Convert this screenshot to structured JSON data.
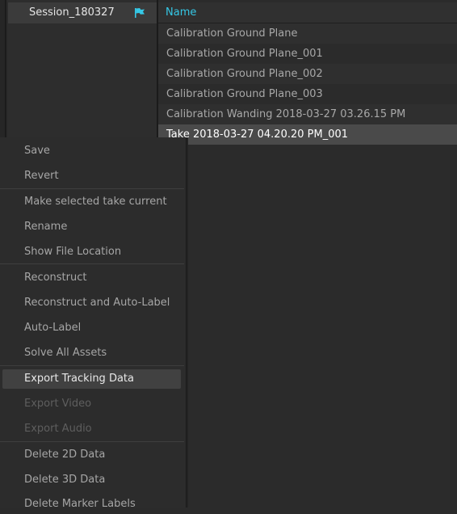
{
  "session_panel": {
    "session_label": "Session_180327",
    "flag_icon_color": "#35c8e6"
  },
  "take_list": {
    "header_label": "Name",
    "rows": [
      {
        "label": "Calibration Ground Plane"
      },
      {
        "label": "Calibration Ground Plane_001"
      },
      {
        "label": "Calibration Ground Plane_002"
      },
      {
        "label": "Calibration Ground Plane_003"
      },
      {
        "label": "Calibration Wanding 2018-03-27 03.26.15 PM"
      },
      {
        "label": "Take 2018-03-27 04.20.20 PM_001"
      }
    ]
  },
  "context_menu": {
    "save": "Save",
    "revert": "Revert",
    "make_current": "Make selected take current",
    "rename": "Rename",
    "show_file_location": "Show File Location",
    "reconstruct": "Reconstruct",
    "reconstruct_auto_label": "Reconstruct and Auto-Label",
    "auto_label": "Auto-Label",
    "solve_all_assets": "Solve All Assets",
    "export_tracking_data": "Export Tracking Data",
    "export_video": "Export Video",
    "export_audio": "Export Audio",
    "delete_2d_data": "Delete 2D Data",
    "delete_3d_data": "Delete 3D Data",
    "delete_marker_labels": "Delete Marker Labels"
  }
}
